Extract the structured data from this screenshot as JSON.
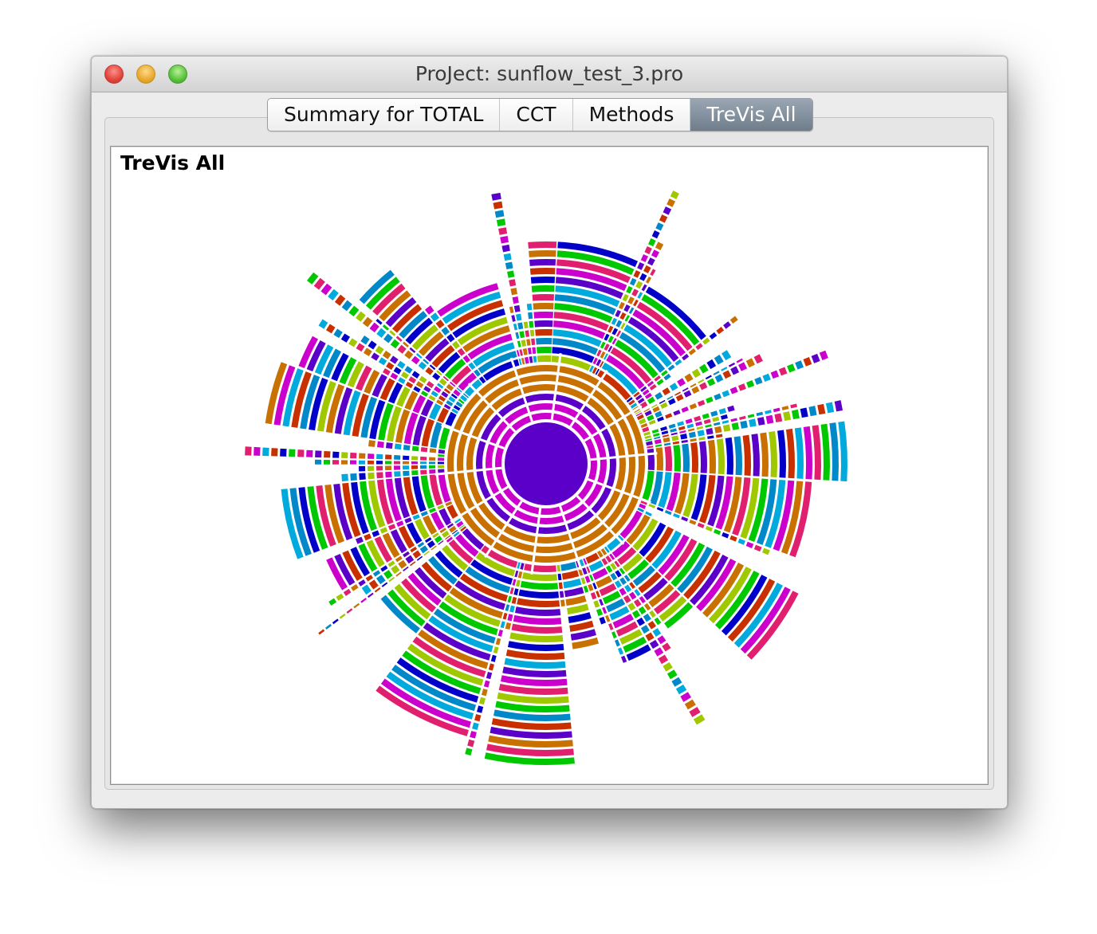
{
  "window": {
    "title": "ProJect: sunflow_test_3.pro"
  },
  "tabs": [
    {
      "label": "Summary for TOTAL",
      "selected": false
    },
    {
      "label": "CCT",
      "selected": false
    },
    {
      "label": "Methods",
      "selected": false
    },
    {
      "label": "TreVis All",
      "selected": true
    }
  ],
  "panel": {
    "title": "TreVis All"
  },
  "palette": [
    "#5a00c8",
    "#cc00cc",
    "#c87000",
    "#e0206e",
    "#a0c800",
    "#00c800",
    "#0000c8",
    "#0088c8",
    "#c83000",
    "#00aadd"
  ]
}
